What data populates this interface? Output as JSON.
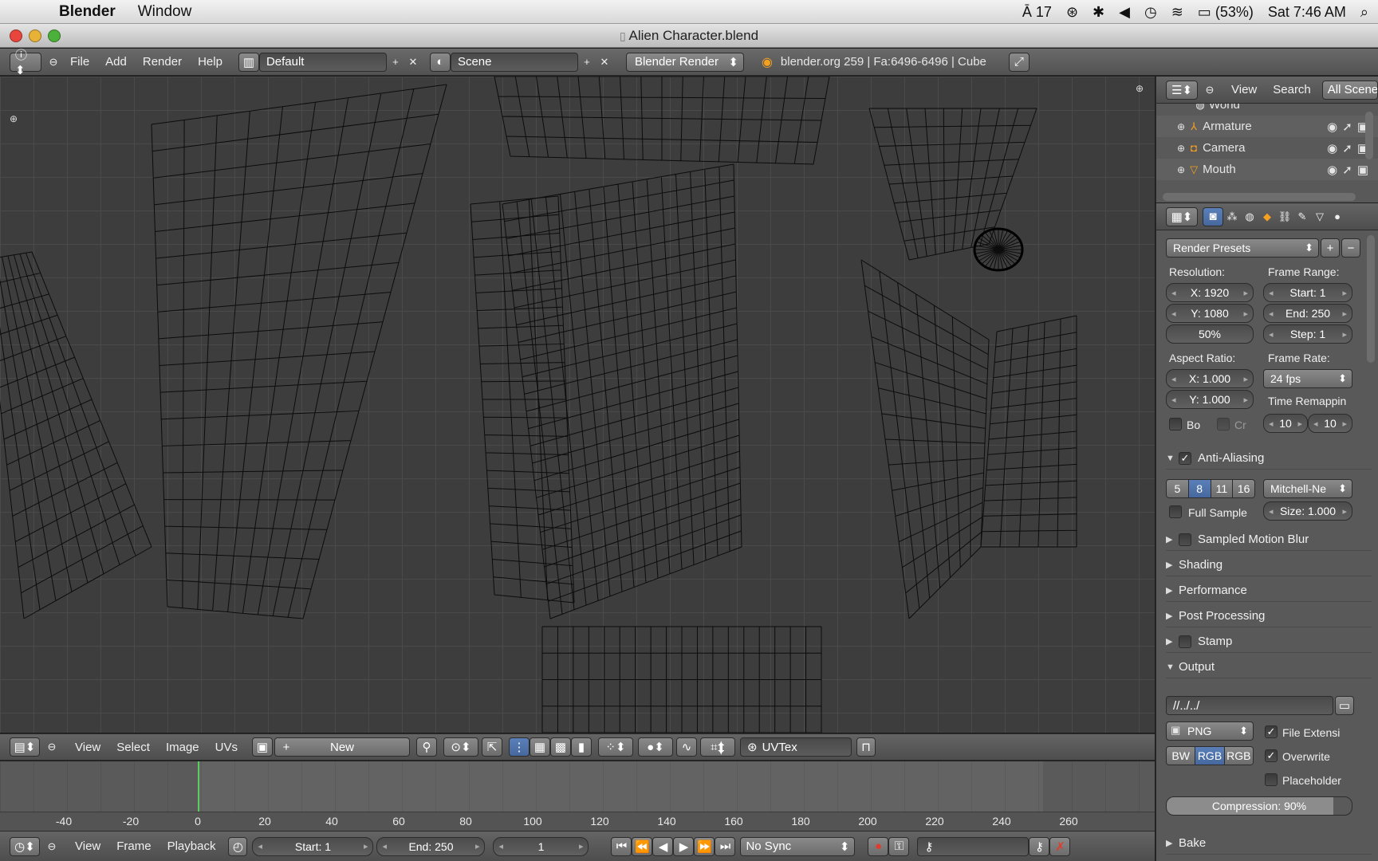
{
  "menubar": {
    "app_name": "Blender",
    "items": [
      "Window"
    ],
    "status": {
      "input_source": "17",
      "battery": "(53%)",
      "clock": "Sat 7:46 AM"
    }
  },
  "window": {
    "title": "Alien Character.blend"
  },
  "info_header": {
    "menus": [
      "File",
      "Add",
      "Render",
      "Help"
    ],
    "layout": "Default",
    "scene": "Scene",
    "engine": "Blender Render",
    "stats": "blender.org 259 | Fa:6496-6496 | Cube"
  },
  "uv_header": {
    "menus": [
      "View",
      "Select",
      "Image",
      "UVs"
    ],
    "new_label": "New",
    "uv_map": "UVTex"
  },
  "timeline": {
    "ticks": [
      "-40",
      "-20",
      "0",
      "20",
      "40",
      "60",
      "80",
      "100",
      "120",
      "140",
      "160",
      "180",
      "200",
      "220",
      "240",
      "260"
    ],
    "menus": [
      "View",
      "Frame",
      "Playback"
    ],
    "start": "Start: 1",
    "end": "End: 250",
    "current": "1",
    "sync": "No Sync"
  },
  "outliner": {
    "menus": [
      "View",
      "Search"
    ],
    "filter": "All Scenes",
    "items": [
      {
        "label": "World"
      },
      {
        "label": "Armature"
      },
      {
        "label": "Camera"
      },
      {
        "label": "Mouth"
      }
    ]
  },
  "properties": {
    "presets": "Render Presets",
    "resolution_label": "Resolution:",
    "res_x": "X: 1920",
    "res_y": "Y: 1080",
    "res_pct": "50%",
    "frame_range_label": "Frame Range:",
    "start": "Start: 1",
    "end": "End: 250",
    "step": "Step: 1",
    "aspect_label": "Aspect Ratio:",
    "aspect_x": "X: 1.000",
    "aspect_y": "Y: 1.000",
    "frame_rate_label": "Frame Rate:",
    "fps": "24 fps",
    "time_remap_label": "Time Remappin",
    "remap_old": "10",
    "remap_new": "10",
    "border_label": "Bo",
    "crop_label": "Cr",
    "aa_label": "Anti-Aliasing",
    "aa_samples": [
      "5",
      "8",
      "11",
      "16"
    ],
    "aa_filter": "Mitchell-Ne",
    "full_sample": "Full Sample",
    "filter_size": "Size: 1.000",
    "sections": [
      "Sampled Motion Blur",
      "Shading",
      "Performance",
      "Post Processing",
      "Stamp"
    ],
    "output_label": "Output",
    "output_path": "//../../",
    "format": "PNG",
    "file_ext": "File Extensi",
    "color_modes": [
      "BW",
      "RGB",
      "RGB"
    ],
    "overwrite": "Overwrite",
    "placeholder": "Placeholder",
    "compression": "Compression: 90%",
    "bake": "Bake"
  }
}
